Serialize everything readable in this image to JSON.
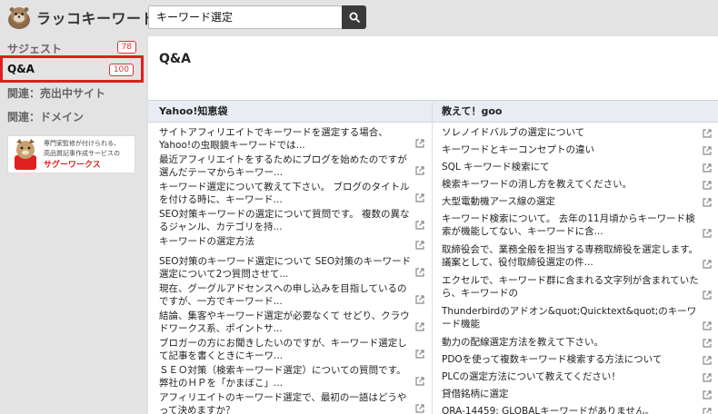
{
  "header": {
    "logo_text": "ラッコキーワード",
    "search_value": "キーワード選定"
  },
  "sidebar": {
    "items": [
      {
        "label": "サジェスト",
        "badge": "78"
      },
      {
        "label": "Q&A",
        "badge": "100"
      },
      {
        "label": "関連：売出中サイト"
      },
      {
        "label": "関連：ドメイン"
      }
    ],
    "ad": {
      "line1": "専門家監修が付けられる、",
      "line2": "高品質記事作成サービスの",
      "brand": "サグーワークス"
    }
  },
  "main": {
    "title": "Q&A",
    "columns": [
      {
        "header": "Yahoo!知恵袋",
        "items": [
          "サイトアフィリエイトでキーワードを選定する場合、Yahoo!の虫眼鏡キーワードでは...",
          "最近アフィリエイトをするためにブログを始めたのですが選んだテーマからキーワー...",
          "キーワード選定について教えて下さい。 ブログのタイトルを付ける時に、キーワード...",
          "SEO対策キーワードの選定について質問です。 複数の異なるジャンル、カテゴリを持...",
          "キーワードの選定方法",
          "SEO対策のキーワード選定について SEO対策のキーワード選定について2つ質問させて...",
          "現在、グーグルアドセンスへの申し込みを目指しているのですが、一方でキーワード...",
          "結論、集客やキーワード選定が必要なくて せどり、クラウドワークス系、ポイントサ...",
          "ブロガーの方にお聞きしたいのですが、キーワード選定して記事を書くときにキーワ...",
          "ＳＥＯ対策（検索キーワード選定）についての質問です。 弊社のＨＰを「かまぼこ」...",
          "アフィリエイトのキーワード選定で、最初の一語はどうやって決めますか？"
        ]
      },
      {
        "header": "教えて！goo",
        "items": [
          "ソレノイドバルブの選定について",
          "キーワードとキーコンセプトの違い",
          "SQL キーワード検索にて",
          "検索キーワードの消し方を教えてください。",
          "大型電動機アース線の選定",
          "キーワード検索について。 去年の11月頃からキーワード検索が機能してない、キーワードに含...",
          "取締役会で、業務全般を担当する専務取締役を選定します。議案として、役付取締役選定の件...",
          "エクセルで、キーワード群に含まれる文字列が含まれていたら、キーワードの",
          "Thunderbirdのアドオン&quot;Quicktext&quot;のキーワード機能",
          "動力の配線選定方法を教えて下さい。",
          "PDOを使って複数キーワード検索する方法について",
          "PLCの選定方法について教えてください！",
          "貸借銘柄に選定",
          "ORA-14459: GLOBALキーワードがありません。"
        ]
      }
    ]
  }
}
